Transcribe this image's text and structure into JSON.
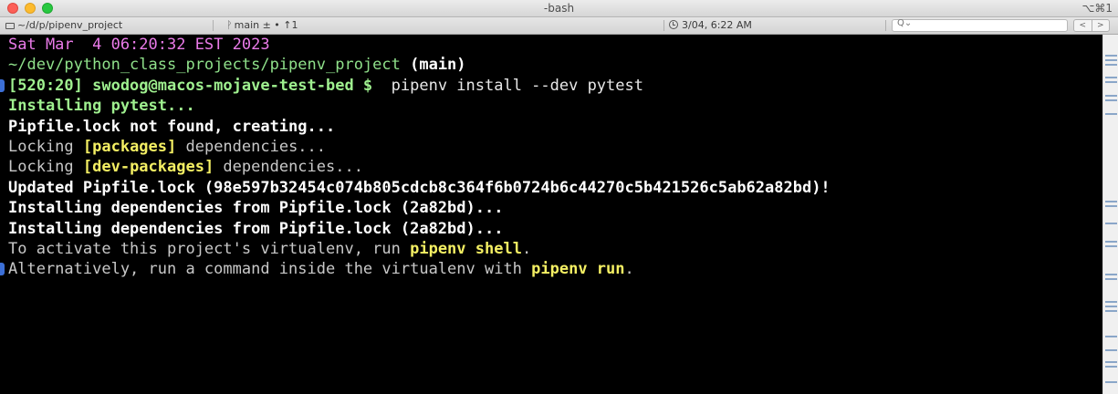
{
  "window": {
    "title": "-bash",
    "shortcut": "⌥⌘1"
  },
  "statusbar": {
    "path": "~/d/p/pipenv_project",
    "branch_icon": "ᚹ",
    "branch": "main ± • ↑1",
    "datetime": "3/04, 6:22 AM",
    "search_placeholder": "Q⌄",
    "nav_prev": "<",
    "nav_next": ">"
  },
  "terminal": {
    "date_line": "Sat Mar  4 06:20:32 EST 2023",
    "cwd": "~/dev/python_class_projects/pipenv_project",
    "git_branch": " (main)",
    "prompt": "[520:20] swodog@macos-mojave-test-bed $ ",
    "command": " pipenv install --dev pytest",
    "out1": "Installing pytest...",
    "out2": "Pipfile.lock not found, creating...",
    "out3_a": "Locking ",
    "out3_b": "[packages]",
    "out3_c": " dependencies...",
    "out4_a": "Locking ",
    "out4_b": "[dev-packages]",
    "out4_c": " dependencies...",
    "out5": "Updated Pipfile.lock (98e597b32454c074b805cdcb8c364f6b0724b6c44270c5b421526c5ab62a82bd)!",
    "out6": "Installing dependencies from Pipfile.lock (2a82bd)...",
    "out7": "Installing dependencies from Pipfile.lock (2a82bd)...",
    "out8_a": "To activate this project's virtualenv, run ",
    "out8_b": "pipenv shell",
    "out8_c": ".",
    "out9_a": "Alternatively, run a command inside the virtualenv with ",
    "out9_b": "pipenv run",
    "out9_c": "."
  },
  "colors": {
    "prompt_marker": "#3c6fd6",
    "magenta": "#ea7be9",
    "green": "#8fe08a",
    "yellow": "#f4ef63"
  }
}
